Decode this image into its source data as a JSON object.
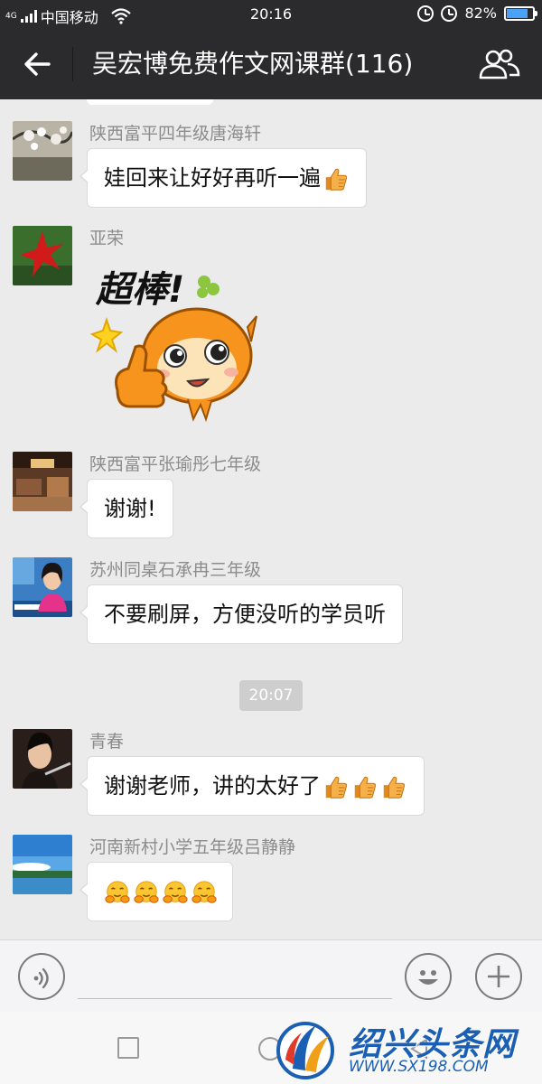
{
  "status_bar": {
    "network": "4G",
    "carrier": "中国移动",
    "time": "20:16",
    "battery": "82%",
    "battery_level": 0.82
  },
  "header": {
    "title": "吴宏博免费作文网课群(116)"
  },
  "messages": [
    {
      "sender": "陕西富平四年级唐海轩",
      "text": "娃回来让好好再听一遍",
      "emojis": [
        "thumbs-up"
      ]
    },
    {
      "sender": "亚荣",
      "sticker_text": "超棒!"
    },
    {
      "sender": "陕西富平张瑜彤七年级",
      "text": "谢谢!"
    },
    {
      "sender": "苏州同桌石承冉三年级",
      "text": "不要刷屏，方便没听的学员听"
    },
    {
      "sender": "青春",
      "text": "谢谢老师，讲的太好了",
      "emojis": [
        "thumbs-up",
        "thumbs-up",
        "thumbs-up"
      ]
    },
    {
      "sender": "河南新村小学五年级吕静静",
      "text": "",
      "emojis": [
        "hug-face",
        "hug-face",
        "hug-face",
        "hug-face"
      ]
    }
  ],
  "timestamp": "20:07",
  "input": {
    "value": "",
    "placeholder": ""
  },
  "watermark": {
    "name": "绍兴头条网",
    "url": "WWW.SX198.COM"
  },
  "colors": {
    "header_bg": "#2b2b2d",
    "chat_bg": "#ebebeb",
    "brand_blue": "#1a5fb4",
    "battery_fill": "#49a2f5"
  }
}
